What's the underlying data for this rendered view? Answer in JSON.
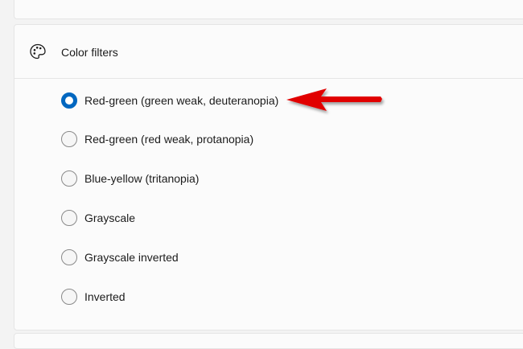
{
  "header": {
    "title": "Color filters",
    "icon": "palette-icon"
  },
  "options": [
    {
      "label": "Red-green (green weak, deuteranopia)",
      "checked": true
    },
    {
      "label": "Red-green (red weak, protanopia)",
      "checked": false
    },
    {
      "label": "Blue-yellow (tritanopia)",
      "checked": false
    },
    {
      "label": "Grayscale",
      "checked": false
    },
    {
      "label": "Grayscale inverted",
      "checked": false
    },
    {
      "label": "Inverted",
      "checked": false
    }
  ],
  "colors": {
    "accent": "#0067c0",
    "annotation_arrow": "#e10000"
  }
}
